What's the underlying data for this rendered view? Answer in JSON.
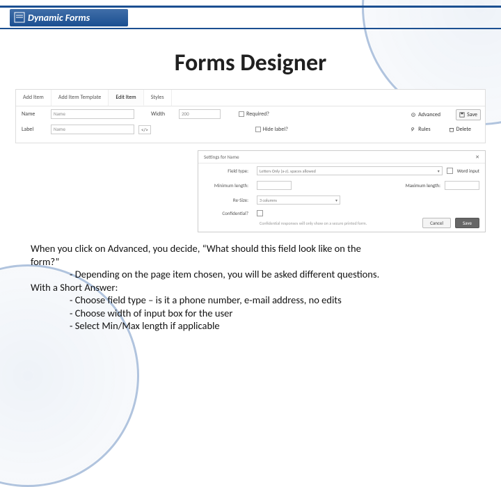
{
  "logo_text": "Dynamic Forms",
  "title": "Forms Designer",
  "panel1": {
    "tabs": [
      "Add Item",
      "Add Item Template",
      "Edit Item",
      "Styles"
    ],
    "active_tab_index": 2,
    "name_label": "Name",
    "name_value": "Name",
    "width_label": "Width",
    "width_value": "200",
    "required_label": "Required?",
    "label_label": "Label",
    "label_value": "Name",
    "hide_label": "Hide label?",
    "advanced_label": "Advanced",
    "rules_label": "Rules",
    "save_label": "Save",
    "delete_label": "Delete"
  },
  "panel2": {
    "header": "Settings for Name",
    "close": "✕",
    "field_type_label": "Field type:",
    "field_type_value": "Letters Only (a-z), spaces allowed",
    "word_input_label": "Word input",
    "min_label": "Minimum length:",
    "min_value": "",
    "max_label": "Maximum length:",
    "max_value": "",
    "resize_label": "Re-Size:",
    "resize_value": "3 columns",
    "confidential_label": "Confidential?",
    "confidential_note": "Confidential responses will only show on a secure printed form.",
    "cancel_label": "Cancel",
    "save_label": "Save"
  },
  "body": {
    "l1": "When you click on Advanced, you decide, “What should this field look like on the",
    "l2": "form?”",
    "l3": "- Depending on the page item chosen, you will be asked different questions.",
    "l4": "With a Short Answer:",
    "l5": "- Choose field type – is it a phone number, e-mail address, no edits",
    "l6": "- Choose width of input box for the user",
    "l7": "- Select Min/Max length if applicable"
  }
}
